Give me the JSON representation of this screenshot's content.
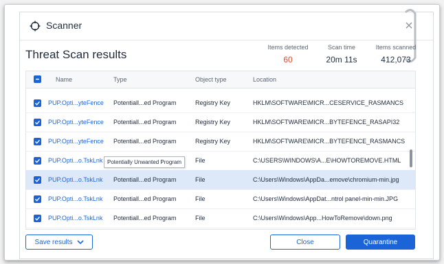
{
  "title": "Scanner",
  "heading": "Threat Scan results",
  "stats": [
    {
      "label": "Items detected",
      "value": "60",
      "color": "#d84f2a"
    },
    {
      "label": "Scan time",
      "value": "20m 11s"
    },
    {
      "label": "Items scanned",
      "value": "412,073"
    }
  ],
  "columns": {
    "name": "Name",
    "type": "Type",
    "object_type": "Object type",
    "location": "Location"
  },
  "rows": [
    {
      "name": "PUP.Opti...yteFence",
      "type": "Potentiall...ed Program",
      "object_type": "Registry Key",
      "location": "HKLM\\SOFTWARE\\MICR...CESERVICE_RASMANCS"
    },
    {
      "name": "PUP.Opti...yteFence",
      "type": "Potentiall...ed Program",
      "object_type": "Registry Key",
      "location": "HKLM\\SOFTWARE\\MICR...BYTEFENCE_RASAPI32"
    },
    {
      "name": "PUP.Opti...yteFence",
      "type": "Potentiall...ed Program",
      "object_type": "Registry Key",
      "location": "HKLM\\SOFTWARE\\MICR...BYTEFENCE_RASMANCS"
    },
    {
      "name": "PUP.Opti...o.TskLnk",
      "type": "",
      "object_type": "File",
      "location": "C:\\USERS\\WINDOWS\\A...E\\HOWTOREMOVE.HTML"
    },
    {
      "name": "PUP.Opti...o.TskLnk",
      "type": "Potentiall...ed Program",
      "object_type": "File",
      "location": "C:\\Users\\Windows\\AppDa...emove\\chromium-min.jpg"
    },
    {
      "name": "PUP.Opti...o.TskLnk",
      "type": "Potentiall...ed Program",
      "object_type": "File",
      "location": "C:\\Users\\Windows\\AppDat...ntrol panel-min-min.JPG"
    },
    {
      "name": "PUP.Opti...o.TskLnk",
      "type": "Potentiall...ed Program",
      "object_type": "File",
      "location": "C:\\Users\\Windows\\App...HowToRemove\\down.png"
    }
  ],
  "tooltip": "Potentially Unwanted Program",
  "buttons": {
    "save": "Save results",
    "close": "Close",
    "quarantine": "Quarantine"
  },
  "colors": {
    "accent": "#1b64d8",
    "alert": "#d84f2a",
    "selected_row": "#dde8f8"
  },
  "icons": {
    "title": "crosshair-icon",
    "close": "close-icon",
    "dropdown": "chevron-down-icon",
    "check": "check-icon"
  }
}
